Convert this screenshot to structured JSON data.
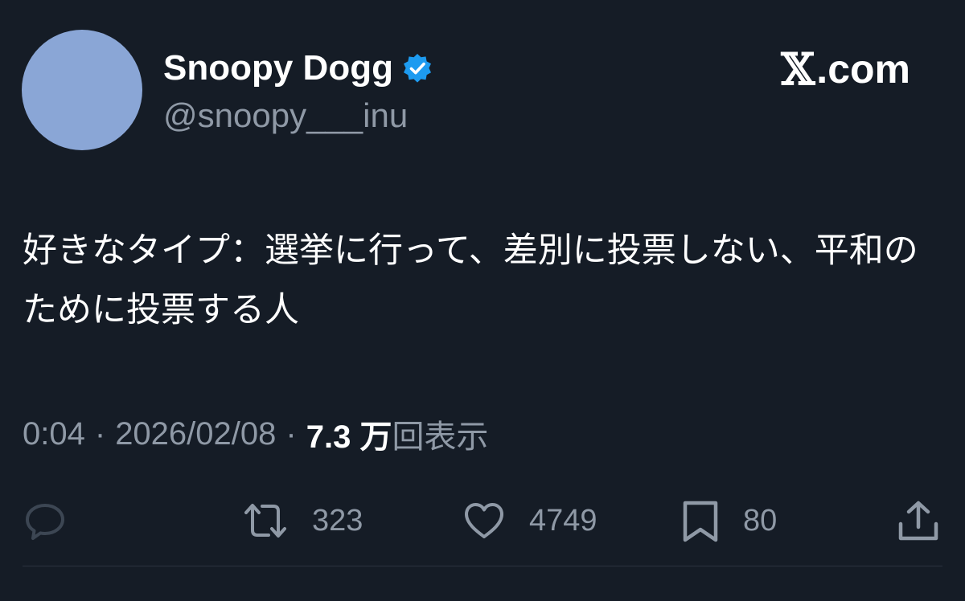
{
  "brand": {
    "icon": "x-logo-icon",
    "label": ".com"
  },
  "user": {
    "display_name": "Snoopy Dogg",
    "handle": "@snoopy___inu",
    "verified": true,
    "avatar_color": "#8aa6d6"
  },
  "tweet": {
    "text": "好きなタイプ：選挙に行って、差別に投票しない、平和のために投票する人"
  },
  "meta": {
    "time": "0:04",
    "separator": "·",
    "date": "2026/02/08",
    "views_count": "7.3 万",
    "views_label": "回表示"
  },
  "actions": {
    "reply": {
      "icon": "reply-icon",
      "count": ""
    },
    "retweet": {
      "icon": "retweet-icon",
      "count": "323"
    },
    "like": {
      "icon": "heart-icon",
      "count": "4749"
    },
    "bookmark": {
      "icon": "bookmark-icon",
      "count": "80"
    },
    "share": {
      "icon": "share-icon",
      "count": ""
    }
  },
  "colors": {
    "background": "#151c26",
    "text_primary": "#ffffff",
    "text_secondary": "#8f99a6",
    "verified_blue": "#1d9bf0"
  }
}
